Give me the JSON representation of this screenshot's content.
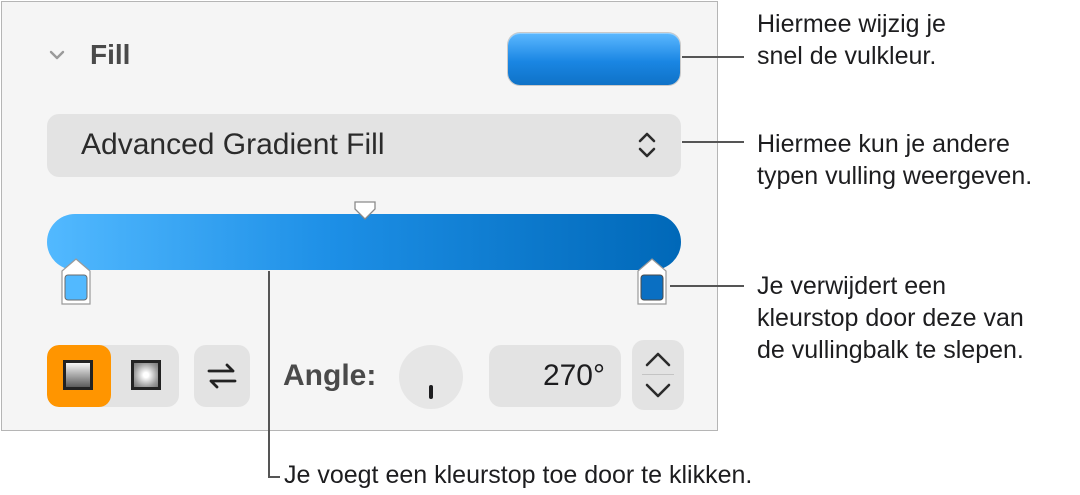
{
  "fill": {
    "section_title": "Fill",
    "color_well_color": "#1a86e3",
    "fill_type": "Advanced Gradient Fill",
    "gradient": {
      "start_color": "#52b9ff",
      "end_color": "#0068b8",
      "stops": [
        {
          "name": "left",
          "color": "#52b9ff"
        },
        {
          "name": "right",
          "color": "#0a6fc2"
        }
      ]
    },
    "angle_label": "Angle:",
    "angle_value": "270°",
    "accent_color": "#ff9500"
  },
  "icons": {
    "collapse": "chevron-down-icon",
    "popup": "up-down-chevron-icon",
    "linear": "linear-gradient-icon",
    "radial": "radial-gradient-icon",
    "flip": "swap-arrows-icon",
    "stepper_up": "chevron-up-icon",
    "stepper_down": "chevron-down-icon"
  },
  "callouts": {
    "color_well": [
      "Hiermee wijzig je",
      "snel de vulkleur."
    ],
    "fill_type": [
      "Hiermee kun je andere",
      "typen vulling weergeven."
    ],
    "remove_stop": [
      "Je verwijdert een",
      "kleurstop door deze van",
      "de vullingbalk te slepen."
    ],
    "add_stop": [
      "Je voegt een kleurstop toe door te klikken."
    ]
  }
}
